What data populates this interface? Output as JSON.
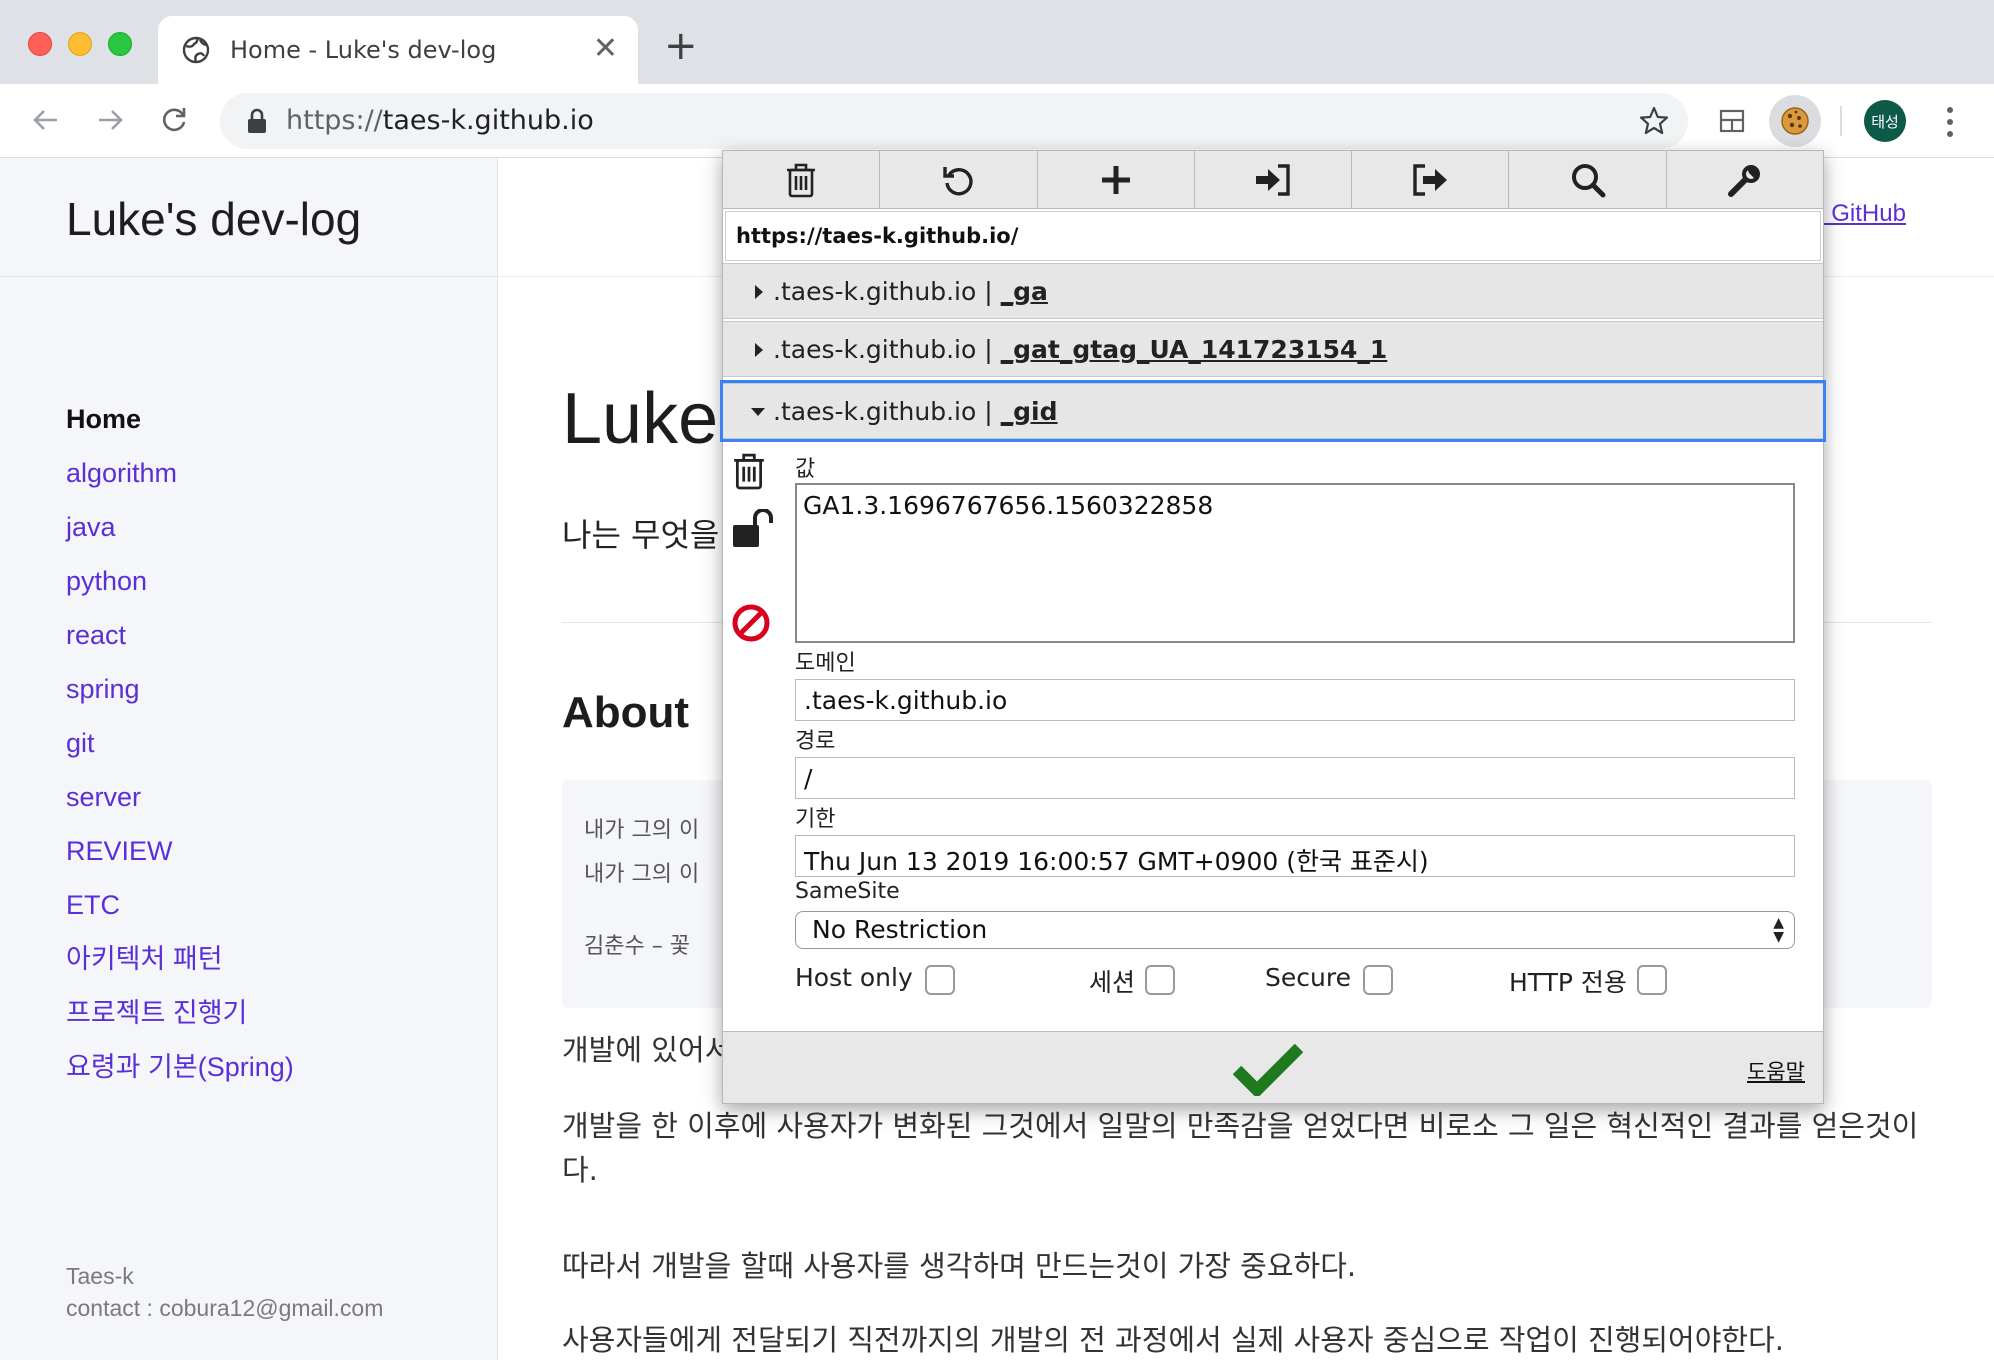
{
  "browser": {
    "tab_title": "Home - Luke's dev-log",
    "tab_close": "✕",
    "new_tab": "+",
    "url_scheme": "https://",
    "url_host": "taes-k.github.io",
    "avatar_text": "태성"
  },
  "sidebar": {
    "site_title": "Luke's dev-log",
    "items": [
      {
        "label": "Home",
        "active": true
      },
      {
        "label": "algorithm"
      },
      {
        "label": "java"
      },
      {
        "label": "python"
      },
      {
        "label": "react"
      },
      {
        "label": "spring"
      },
      {
        "label": "git"
      },
      {
        "label": "server"
      },
      {
        "label": "REVIEW"
      },
      {
        "label": "ETC"
      },
      {
        "label": "아키텍처 패턴"
      },
      {
        "label": "프로젝트 진행기"
      },
      {
        "label": "요령과 기본(Spring)"
      }
    ],
    "footer_name": "Taes-k",
    "footer_contact": "contact : cobura12@gmail.com"
  },
  "main": {
    "github_link": "'s GitHub",
    "post_title": "Luke'",
    "post_sub": "나는 무엇을",
    "about_heading": "About",
    "quote_lines": [
      "내가  그의  이",
      "내가  그의  이",
      "김춘수  –  꽃"
    ],
    "paragraphs": [
      "개발에 있어서",
      "개발을 한 이후에 사용자가 변화된 그것에서 일말의 만족감을 얻었다면 비로소 그 일은 혁신적인 결과를 얻은것이다.",
      "따라서 개발을 할때 사용자를 생각하며 만드는것이 가장 중요하다.",
      "사용자들에게 전달되기 직전까지의 개발의 전 과정에서 실제 사용자 중심으로 작업이 진행되어야한다."
    ]
  },
  "cookie_editor": {
    "toolbar_icons": [
      "trash-icon",
      "reload-icon",
      "plus-icon",
      "import-icon",
      "export-icon",
      "search-icon",
      "wrench-icon"
    ],
    "url": "https://taes-k.github.io/",
    "cookies": [
      {
        "domain": ".taes-k.github.io",
        "sep": "|",
        "name": "_ga"
      },
      {
        "domain": ".taes-k.github.io",
        "sep": "|",
        "name": "_gat_gtag_UA_141723154_1"
      },
      {
        "domain": ".taes-k.github.io",
        "sep": "|",
        "name": "_gid"
      }
    ],
    "labels": {
      "value": "값",
      "domain": "도메인",
      "path": "경로",
      "expires": "기한",
      "samesite": "SameSite",
      "host_only": "Host only",
      "session": "세션",
      "secure": "Secure",
      "http_only": "HTTP 전용",
      "help": "도움말"
    },
    "fields": {
      "value": "GA1.3.1696767656.1560322858",
      "domain": ".taes-k.github.io",
      "path": "/",
      "expires": "Thu Jun 13 2019 16:00:57 GMT+0900 (한국 표준시)",
      "samesite": "No Restriction"
    },
    "checkboxes": {
      "host_only": false,
      "session": false,
      "secure": false,
      "http_only": false
    },
    "colors": {
      "accent": "#3b82f6",
      "check": "#1f7a1f",
      "forbid": "#d9001b"
    }
  }
}
